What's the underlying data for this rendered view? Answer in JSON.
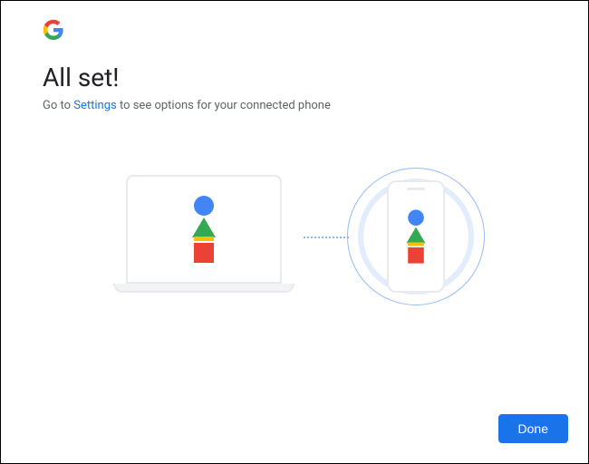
{
  "header": {
    "logo_name": "google-g-logo"
  },
  "title": "All set!",
  "subtitle": {
    "prefix": "Go to ",
    "link_text": "Settings",
    "suffix": " to see options for your connected phone"
  },
  "illustration": {
    "shapes": [
      "blue-circle",
      "green-triangle",
      "yellow-bar",
      "red-square"
    ],
    "description": "Laptop and phone connected"
  },
  "actions": {
    "done_label": "Done"
  },
  "colors": {
    "google_blue": "#4285F4",
    "google_red": "#EA4335",
    "google_yellow": "#FBBC05",
    "google_green": "#34A853",
    "link_blue": "#1a73e8",
    "text_primary": "#202124",
    "text_secondary": "#5f6368",
    "outline_grey": "#e8eaed"
  }
}
